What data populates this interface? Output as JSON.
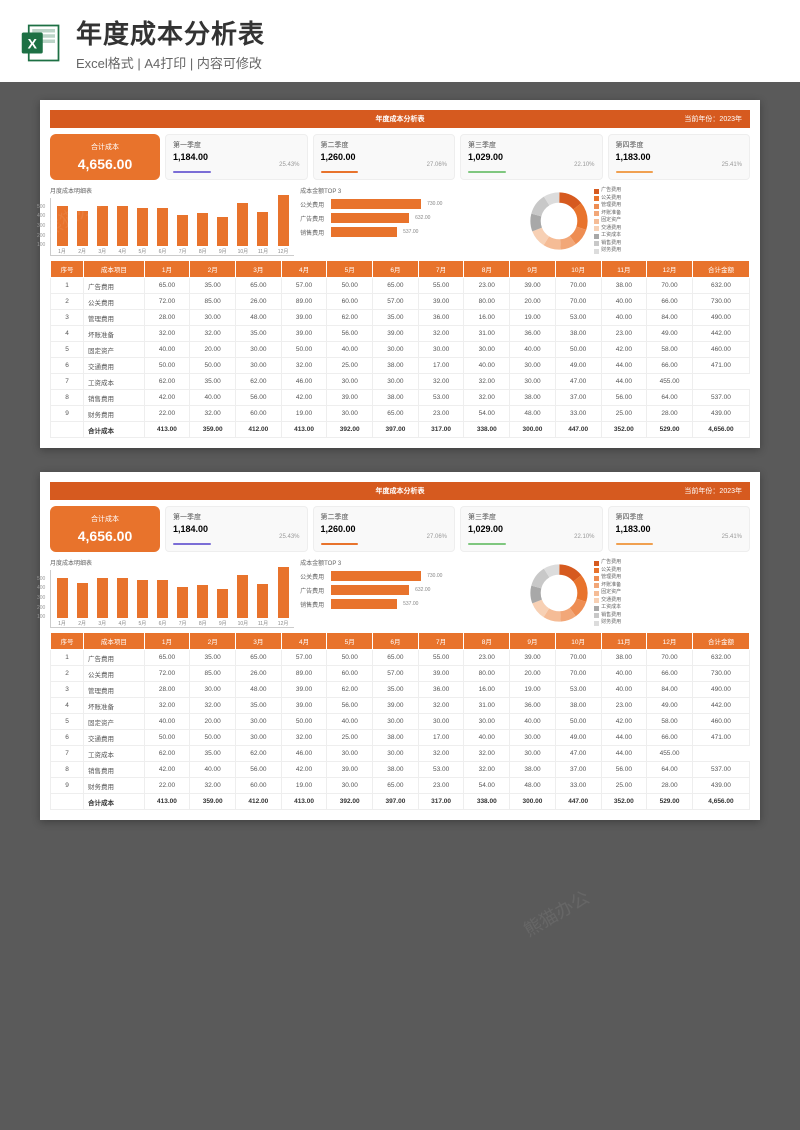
{
  "header": {
    "title": "年度成本分析表",
    "subtitle": "Excel格式 | A4打印 | 内容可修改"
  },
  "sheet": {
    "title": "年度成本分析表",
    "year_label": "当前年份：",
    "year": "2023年",
    "total": {
      "label": "合计成本",
      "value": "4,656.00"
    },
    "quarters": [
      {
        "label": "第一季度",
        "value": "1,184.00",
        "pct": "25.43%",
        "color": "#7b6dd6"
      },
      {
        "label": "第二季度",
        "value": "1,260.00",
        "pct": "27.06%",
        "color": "#e8732c"
      },
      {
        "label": "第三季度",
        "value": "1,029.00",
        "pct": "22.10%",
        "color": "#7fc77f"
      },
      {
        "label": "第四季度",
        "value": "1,183.00",
        "pct": "25.41%",
        "color": "#f0a050"
      }
    ],
    "bar_chart_title": "月度成本明细表",
    "hbar_chart_title": "成本金额TOP 3",
    "top3": [
      {
        "label": "公关费用",
        "value": "730.00",
        "w": 90
      },
      {
        "label": "广告费用",
        "value": "632.00",
        "w": 78
      },
      {
        "label": "销售费用",
        "value": "537.00",
        "w": 66
      }
    ],
    "categories": [
      "广告费用",
      "公关费用",
      "管理费用",
      "坏账准备",
      "固定资产",
      "交通费用",
      "工资成本",
      "销售费用",
      "财务费用"
    ],
    "pie_colors": [
      "#d65a1f",
      "#e8732c",
      "#ee8d52",
      "#f2a778",
      "#f5bc96",
      "#f7d0b4",
      "#a8a8a8",
      "#c8c8c8",
      "#dcdcdc"
    ],
    "pie_pct": [
      "14%",
      "16%",
      "10%",
      "9%",
      "10%",
      "10%",
      "10%",
      "12%",
      "9%"
    ],
    "table": {
      "headers": [
        "序号",
        "成本项目",
        "1月",
        "2月",
        "3月",
        "4月",
        "5月",
        "6月",
        "7月",
        "8月",
        "9月",
        "10月",
        "11月",
        "12月",
        "合计金额"
      ],
      "rows": [
        [
          "1",
          "广告费用",
          "65.00",
          "35.00",
          "65.00",
          "57.00",
          "50.00",
          "65.00",
          "55.00",
          "23.00",
          "39.00",
          "70.00",
          "38.00",
          "70.00",
          "632.00"
        ],
        [
          "2",
          "公关费用",
          "72.00",
          "85.00",
          "26.00",
          "89.00",
          "60.00",
          "57.00",
          "39.00",
          "80.00",
          "20.00",
          "70.00",
          "40.00",
          "66.00",
          "730.00"
        ],
        [
          "3",
          "管理费用",
          "28.00",
          "30.00",
          "48.00",
          "39.00",
          "62.00",
          "35.00",
          "36.00",
          "16.00",
          "19.00",
          "53.00",
          "40.00",
          "84.00",
          "490.00"
        ],
        [
          "4",
          "坏账准备",
          "32.00",
          "32.00",
          "35.00",
          "39.00",
          "56.00",
          "39.00",
          "32.00",
          "31.00",
          "36.00",
          "38.00",
          "23.00",
          "49.00",
          "442.00"
        ],
        [
          "5",
          "固定资产",
          "40.00",
          "20.00",
          "30.00",
          "50.00",
          "40.00",
          "30.00",
          "30.00",
          "30.00",
          "40.00",
          "50.00",
          "42.00",
          "58.00",
          "460.00"
        ],
        [
          "6",
          "交通费用",
          "50.00",
          "50.00",
          "30.00",
          "32.00",
          "25.00",
          "38.00",
          "17.00",
          "40.00",
          "30.00",
          "49.00",
          "44.00",
          "66.00",
          "471.00"
        ],
        [
          "7",
          "工资成本",
          "62.00",
          "35.00",
          "62.00",
          "46.00",
          "30.00",
          "30.00",
          "32.00",
          "32.00",
          "30.00",
          "47.00",
          "44.00",
          "455.00"
        ],
        [
          "8",
          "销售费用",
          "42.00",
          "40.00",
          "56.00",
          "42.00",
          "39.00",
          "38.00",
          "53.00",
          "32.00",
          "38.00",
          "37.00",
          "56.00",
          "64.00",
          "537.00"
        ],
        [
          "9",
          "财务费用",
          "22.00",
          "32.00",
          "60.00",
          "19.00",
          "30.00",
          "65.00",
          "23.00",
          "54.00",
          "48.00",
          "33.00",
          "25.00",
          "28.00",
          "439.00"
        ]
      ],
      "sum": [
        "",
        "合计成本",
        "413.00",
        "359.00",
        "412.00",
        "413.00",
        "392.00",
        "397.00",
        "317.00",
        "338.00",
        "300.00",
        "447.00",
        "352.00",
        "529.00",
        "4,656.00"
      ]
    }
  },
  "chart_data": {
    "type": "bar",
    "title": "月度成本明细表",
    "categories": [
      "1月",
      "2月",
      "3月",
      "4月",
      "5月",
      "6月",
      "7月",
      "8月",
      "9月",
      "10月",
      "11月",
      "12月"
    ],
    "values": [
      413,
      359,
      412,
      413,
      392,
      397,
      317,
      338,
      300,
      447,
      352,
      529
    ],
    "ylim": [
      0,
      600
    ],
    "xlabel": "",
    "ylabel": ""
  }
}
